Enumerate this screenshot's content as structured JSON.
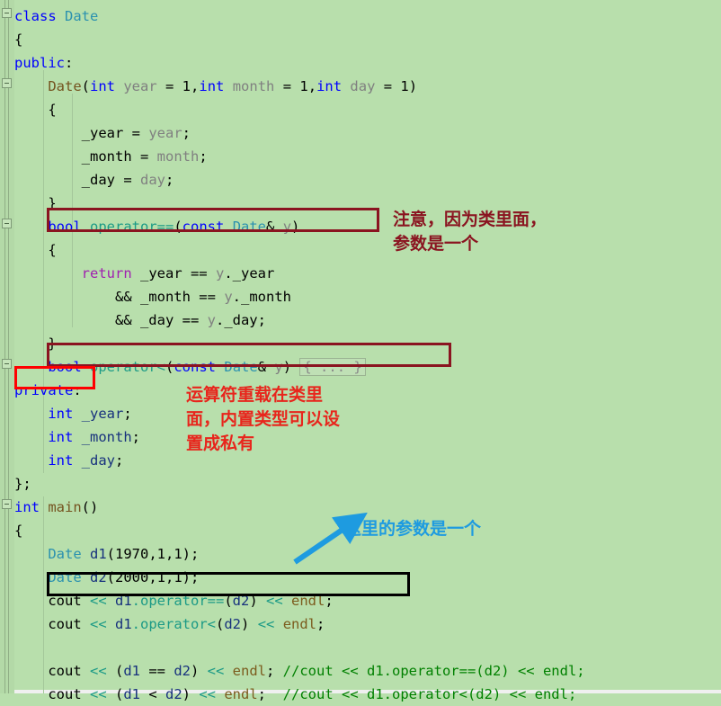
{
  "editor": {
    "background_color": "#b8dfac",
    "language": "C++",
    "colors": {
      "keyword": "#0000ff",
      "type": "#2b91af",
      "function": "#74531f",
      "parameter": "#808080",
      "return_keyword": "#a020b0",
      "stream_operator": "#1b9a86",
      "variable": "#17317d",
      "endl": "#7c5c1e",
      "comment": "#008000",
      "annotation_dark_red": "#8a1420",
      "annotation_red": "#e8251c",
      "annotation_blue": "#1e9be0"
    }
  },
  "code": {
    "lines": [
      {
        "indent": 0,
        "fold": true,
        "tokens": [
          {
            "t": "class",
            "c": "kw"
          },
          {
            "t": " ",
            "c": "plain"
          },
          {
            "t": "Date",
            "c": "type"
          }
        ]
      },
      {
        "indent": 0,
        "tokens": [
          {
            "t": "{",
            "c": "plain"
          }
        ]
      },
      {
        "indent": 0,
        "tokens": [
          {
            "t": "public",
            "c": "kw"
          },
          {
            "t": ":",
            "c": "plain"
          }
        ]
      },
      {
        "indent": 1,
        "fold": true,
        "tokens": [
          {
            "t": "Date",
            "c": "fn"
          },
          {
            "t": "(",
            "c": "plain"
          },
          {
            "t": "int",
            "c": "kw"
          },
          {
            "t": " ",
            "c": "plain"
          },
          {
            "t": "year",
            "c": "param"
          },
          {
            "t": " = ",
            "c": "plain"
          },
          {
            "t": "1",
            "c": "num"
          },
          {
            "t": ",",
            "c": "plain"
          },
          {
            "t": "int",
            "c": "kw"
          },
          {
            "t": " ",
            "c": "plain"
          },
          {
            "t": "month",
            "c": "param"
          },
          {
            "t": " = ",
            "c": "plain"
          },
          {
            "t": "1",
            "c": "num"
          },
          {
            "t": ",",
            "c": "plain"
          },
          {
            "t": "int",
            "c": "kw"
          },
          {
            "t": " ",
            "c": "plain"
          },
          {
            "t": "day",
            "c": "param"
          },
          {
            "t": " = ",
            "c": "plain"
          },
          {
            "t": "1",
            "c": "num"
          },
          {
            "t": ")",
            "c": "plain"
          }
        ]
      },
      {
        "indent": 1,
        "tokens": [
          {
            "t": "{",
            "c": "plain"
          }
        ]
      },
      {
        "indent": 2,
        "tokens": [
          {
            "t": "_year",
            "c": "plain"
          },
          {
            "t": " = ",
            "c": "plain"
          },
          {
            "t": "year",
            "c": "param"
          },
          {
            "t": ";",
            "c": "plain"
          }
        ]
      },
      {
        "indent": 2,
        "tokens": [
          {
            "t": "_month",
            "c": "plain"
          },
          {
            "t": " = ",
            "c": "plain"
          },
          {
            "t": "month",
            "c": "param"
          },
          {
            "t": ";",
            "c": "plain"
          }
        ]
      },
      {
        "indent": 2,
        "tokens": [
          {
            "t": "_day",
            "c": "plain"
          },
          {
            "t": " = ",
            "c": "plain"
          },
          {
            "t": "day",
            "c": "param"
          },
          {
            "t": ";",
            "c": "plain"
          }
        ]
      },
      {
        "indent": 1,
        "tokens": [
          {
            "t": "}",
            "c": "plain"
          }
        ]
      },
      {
        "indent": 1,
        "fold": true,
        "tokens": [
          {
            "t": "bool",
            "c": "kw"
          },
          {
            "t": " ",
            "c": "plain"
          },
          {
            "t": "operator==",
            "c": "teal"
          },
          {
            "t": "(",
            "c": "plain"
          },
          {
            "t": "const",
            "c": "kw"
          },
          {
            "t": " ",
            "c": "plain"
          },
          {
            "t": "Date",
            "c": "type"
          },
          {
            "t": "& ",
            "c": "plain"
          },
          {
            "t": "y",
            "c": "param"
          },
          {
            "t": ")",
            "c": "plain"
          }
        ]
      },
      {
        "indent": 1,
        "tokens": [
          {
            "t": "{",
            "c": "plain"
          }
        ]
      },
      {
        "indent": 2,
        "tokens": [
          {
            "t": "return",
            "c": "ret"
          },
          {
            "t": " _year == ",
            "c": "plain"
          },
          {
            "t": "y",
            "c": "param"
          },
          {
            "t": "._year",
            "c": "plain"
          }
        ]
      },
      {
        "indent": 3,
        "tokens": [
          {
            "t": "&& _month == ",
            "c": "plain"
          },
          {
            "t": "y",
            "c": "param"
          },
          {
            "t": "._month",
            "c": "plain"
          }
        ]
      },
      {
        "indent": 3,
        "tokens": [
          {
            "t": "&& _day == ",
            "c": "plain"
          },
          {
            "t": "y",
            "c": "param"
          },
          {
            "t": "._day;",
            "c": "plain"
          }
        ]
      },
      {
        "indent": 1,
        "tokens": [
          {
            "t": "}",
            "c": "plain"
          }
        ]
      },
      {
        "indent": 1,
        "fold": true,
        "tokens": [
          {
            "t": "bool",
            "c": "kw"
          },
          {
            "t": " ",
            "c": "plain"
          },
          {
            "t": "operator<",
            "c": "teal"
          },
          {
            "t": "(",
            "c": "plain"
          },
          {
            "t": "const",
            "c": "kw"
          },
          {
            "t": " ",
            "c": "plain"
          },
          {
            "t": "Date",
            "c": "type"
          },
          {
            "t": "& ",
            "c": "plain"
          },
          {
            "t": "y",
            "c": "param"
          },
          {
            "t": ")",
            "c": "plain"
          },
          {
            "t": " ",
            "c": "plain"
          },
          {
            "t": "{ ... }",
            "c": "collapsed"
          }
        ]
      },
      {
        "indent": 0,
        "tokens": [
          {
            "t": "private",
            "c": "kw"
          },
          {
            "t": ":",
            "c": "plain"
          }
        ]
      },
      {
        "indent": 1,
        "tokens": [
          {
            "t": "int",
            "c": "kw"
          },
          {
            "t": " ",
            "c": "plain"
          },
          {
            "t": "_year",
            "c": "navy"
          },
          {
            "t": ";",
            "c": "plain"
          }
        ]
      },
      {
        "indent": 1,
        "tokens": [
          {
            "t": "int",
            "c": "kw"
          },
          {
            "t": " ",
            "c": "plain"
          },
          {
            "t": "_month",
            "c": "navy"
          },
          {
            "t": ";",
            "c": "plain"
          }
        ]
      },
      {
        "indent": 1,
        "tokens": [
          {
            "t": "int",
            "c": "kw"
          },
          {
            "t": " ",
            "c": "plain"
          },
          {
            "t": "_day",
            "c": "navy"
          },
          {
            "t": ";",
            "c": "plain"
          }
        ]
      },
      {
        "indent": 0,
        "tokens": [
          {
            "t": "};",
            "c": "plain"
          }
        ]
      },
      {
        "indent": 0,
        "fold": true,
        "tokens": [
          {
            "t": "int",
            "c": "kw"
          },
          {
            "t": " ",
            "c": "plain"
          },
          {
            "t": "main",
            "c": "fn"
          },
          {
            "t": "()",
            "c": "plain"
          }
        ]
      },
      {
        "indent": 0,
        "tokens": [
          {
            "t": "{",
            "c": "plain"
          }
        ]
      },
      {
        "indent": 1,
        "tokens": [
          {
            "t": "Date",
            "c": "type"
          },
          {
            "t": " ",
            "c": "plain"
          },
          {
            "t": "d1",
            "c": "navy"
          },
          {
            "t": "(1970,1,1);",
            "c": "plain"
          }
        ]
      },
      {
        "indent": 1,
        "tokens": [
          {
            "t": "Date",
            "c": "type"
          },
          {
            "t": " ",
            "c": "plain"
          },
          {
            "t": "d2",
            "c": "navy"
          },
          {
            "t": "(2000,1,1);",
            "c": "plain"
          }
        ]
      },
      {
        "indent": 1,
        "tokens": [
          {
            "t": "cout",
            "c": "plain"
          },
          {
            "t": " << ",
            "c": "teal"
          },
          {
            "t": "d1",
            "c": "navy"
          },
          {
            "t": ".",
            "c": "teal"
          },
          {
            "t": "operator==",
            "c": "teal"
          },
          {
            "t": "(",
            "c": "plain"
          },
          {
            "t": "d2",
            "c": "navy"
          },
          {
            "t": ")",
            "c": "plain"
          },
          {
            "t": " << ",
            "c": "teal"
          },
          {
            "t": "endl",
            "c": "brown"
          },
          {
            "t": ";",
            "c": "plain"
          }
        ]
      },
      {
        "indent": 1,
        "tokens": [
          {
            "t": "cout",
            "c": "plain"
          },
          {
            "t": " << ",
            "c": "teal"
          },
          {
            "t": "d1",
            "c": "navy"
          },
          {
            "t": ".",
            "c": "teal"
          },
          {
            "t": "operator<",
            "c": "teal"
          },
          {
            "t": "(",
            "c": "plain"
          },
          {
            "t": "d2",
            "c": "navy"
          },
          {
            "t": ")",
            "c": "plain"
          },
          {
            "t": " << ",
            "c": "teal"
          },
          {
            "t": "endl",
            "c": "brown"
          },
          {
            "t": ";",
            "c": "plain"
          }
        ]
      },
      {
        "indent": 0,
        "tokens": []
      },
      {
        "indent": 1,
        "tokens": [
          {
            "t": "cout",
            "c": "plain"
          },
          {
            "t": " << ",
            "c": "teal"
          },
          {
            "t": "(",
            "c": "plain"
          },
          {
            "t": "d1",
            "c": "navy"
          },
          {
            "t": " == ",
            "c": "plain"
          },
          {
            "t": "d2",
            "c": "navy"
          },
          {
            "t": ")",
            "c": "plain"
          },
          {
            "t": " << ",
            "c": "teal"
          },
          {
            "t": "endl",
            "c": "brown"
          },
          {
            "t": "; ",
            "c": "plain"
          },
          {
            "t": "//cout << d1.operator==(d2) << endl;",
            "c": "cmt"
          }
        ]
      },
      {
        "indent": 1,
        "tokens": [
          {
            "t": "cout",
            "c": "plain"
          },
          {
            "t": " << ",
            "c": "teal"
          },
          {
            "t": "(",
            "c": "plain"
          },
          {
            "t": "d1",
            "c": "navy"
          },
          {
            "t": " < ",
            "c": "plain"
          },
          {
            "t": "d2",
            "c": "navy"
          },
          {
            "t": ")",
            "c": "plain"
          },
          {
            "t": " << ",
            "c": "teal"
          },
          {
            "t": "endl",
            "c": "brown"
          },
          {
            "t": ";  ",
            "c": "plain"
          },
          {
            "t": "//cout << d1.operator<(d2) << endl;",
            "c": "cmt"
          }
        ]
      }
    ]
  },
  "annotations": {
    "note_operator_equals": "注意，因为类里面，\n参数是一个",
    "note_private": "运算符重载在类里\n面，内置类型可以设\n置成私有",
    "note_main_param": "这里的参数是一个"
  },
  "highlights": {
    "operator_equals_box": "operator== declaration",
    "operator_less_box": "operator< declaration (collapsed)",
    "private_box": "private:",
    "cout_operator_equals_box": "cout << d1.operator==(d2) << endl;"
  }
}
